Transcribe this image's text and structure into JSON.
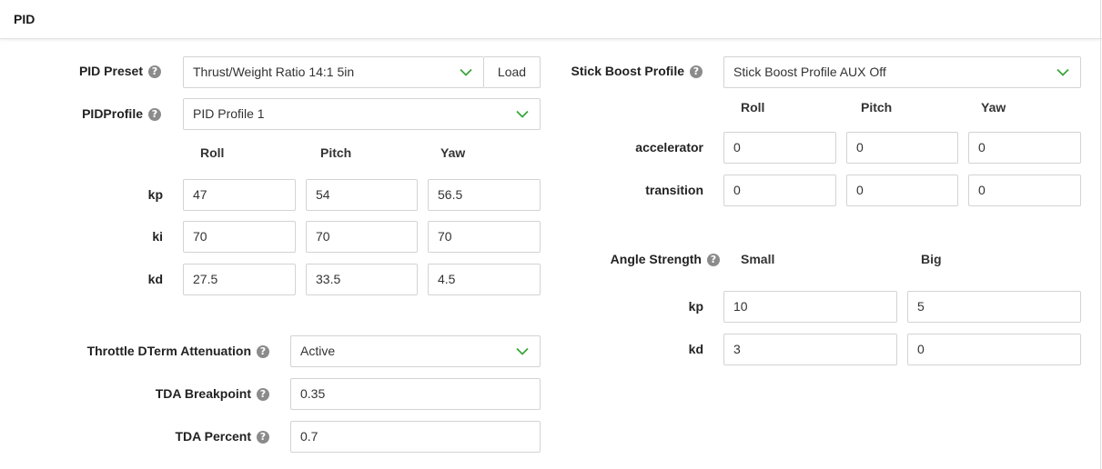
{
  "header": {
    "title": "PID"
  },
  "left": {
    "preset": {
      "label": "PID Preset",
      "value": "Thrust/Weight Ratio 14:1 5in",
      "load_label": "Load"
    },
    "profile": {
      "label": "PIDProfile",
      "value": "PID Profile 1"
    },
    "columns": [
      "Roll",
      "Pitch",
      "Yaw"
    ],
    "rows": [
      {
        "label": "kp",
        "values": [
          "47",
          "54",
          "56.5"
        ]
      },
      {
        "label": "ki",
        "values": [
          "70",
          "70",
          "70"
        ]
      },
      {
        "label": "kd",
        "values": [
          "27.5",
          "33.5",
          "4.5"
        ]
      }
    ],
    "tda": {
      "label": "Throttle DTerm Attenuation",
      "value": "Active"
    },
    "tda_breakpoint": {
      "label": "TDA Breakpoint",
      "value": "0.35"
    },
    "tda_percent": {
      "label": "TDA Percent",
      "value": "0.7"
    }
  },
  "right": {
    "stick_boost": {
      "label": "Stick Boost Profile",
      "value": "Stick Boost Profile AUX Off"
    },
    "columns": [
      "Roll",
      "Pitch",
      "Yaw"
    ],
    "rows": [
      {
        "label": "accelerator",
        "values": [
          "0",
          "0",
          "0"
        ]
      },
      {
        "label": "transition",
        "values": [
          "0",
          "0",
          "0"
        ]
      }
    ],
    "angle": {
      "label": "Angle Strength",
      "columns": [
        "Small",
        "Big"
      ],
      "rows": [
        {
          "label": "kp",
          "values": [
            "10",
            "5"
          ]
        },
        {
          "label": "kd",
          "values": [
            "3",
            "0"
          ]
        }
      ]
    }
  },
  "colors": {
    "chevron": "#3aa63a",
    "help_icon": "#8b8b8b",
    "border": "#d3d3d3"
  }
}
